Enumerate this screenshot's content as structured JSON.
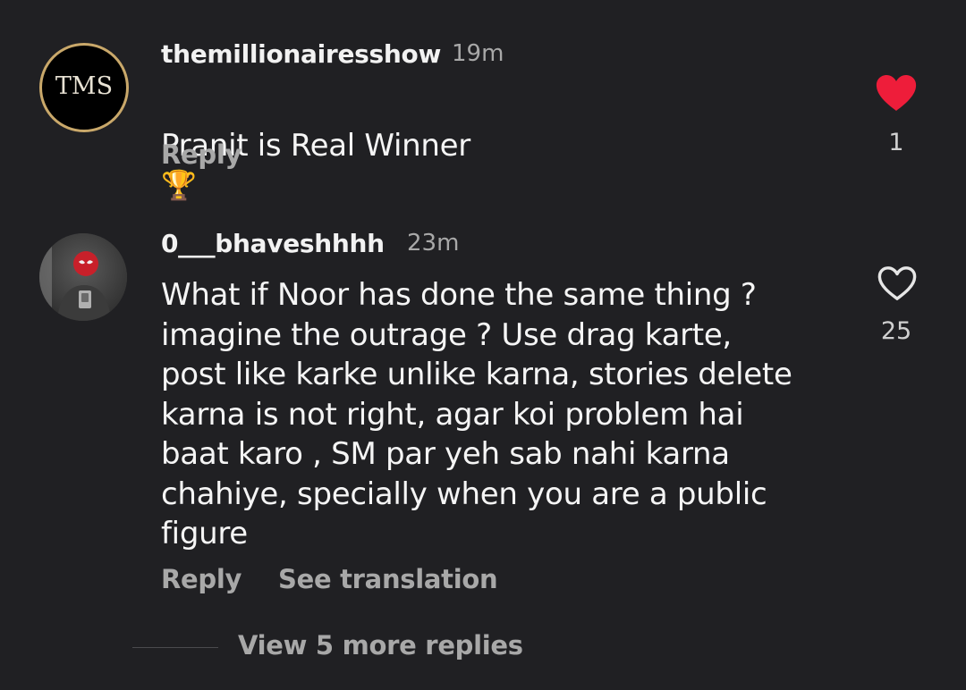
{
  "comments": [
    {
      "avatar_text": "TMS",
      "username": "themillionairesshow",
      "time": "19m",
      "text": "Pranit is Real Winner",
      "emoji": "🏆",
      "reply_label": "Reply",
      "like_count": "1",
      "liked": true
    },
    {
      "username": "0___bhaveshhhh",
      "time": "23m",
      "text": "What if Noor has done the same thing ?\nimagine the outrage ? Use drag karte,\npost like karke unlike karna, stories delete\nkarna is not right, agar koi problem hai\nbaat karo , SM par yeh sab nahi karna\nchahiye, specially when you are a public\nfigure",
      "reply_label": "Reply",
      "translate_label": "See translation",
      "like_count": "25",
      "liked": false
    }
  ],
  "view_more_replies": "View 5 more replies",
  "colors": {
    "background": "#202023",
    "like_red": "#ee1d3a",
    "muted_text": "#a8a8a8",
    "tms_gold_ring": "#c9a86a"
  },
  "icons": {
    "liked": "heart-filled-icon",
    "unliked": "heart-outline-icon",
    "trophy": "trophy-icon"
  }
}
